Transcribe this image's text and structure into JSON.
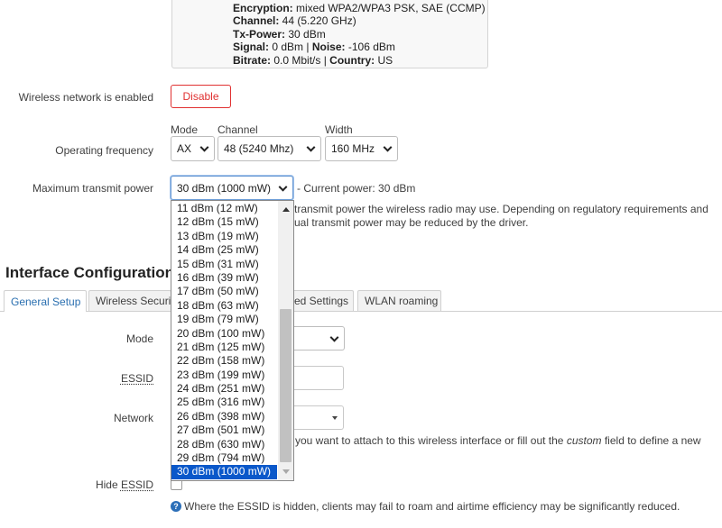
{
  "status": {
    "encryption_label": "Encryption:",
    "encryption_value": " mixed WPA2/WPA3 PSK, SAE (CCMP)",
    "channel_label": "Channel:",
    "channel_value": " 44 (5.220 GHz)",
    "txpower_label": "Tx-Power:",
    "txpower_value": " 30 dBm",
    "signal_label": "Signal:",
    "signal_value": " 0 dBm | ",
    "noise_label": "Noise:",
    "noise_value": " -106 dBm",
    "bitrate_label": "Bitrate:",
    "bitrate_value": " 0.0 Mbit/s | ",
    "country_label": "Country:",
    "country_value": " US"
  },
  "wireless_enabled": {
    "label": "Wireless network is enabled",
    "button": "Disable"
  },
  "frequency": {
    "label": "Operating frequency",
    "mode_label": "Mode",
    "mode_value": "AX",
    "channel_label": "Channel",
    "channel_value": "48 (5240 Mhz)",
    "width_label": "Width",
    "width_value": "160 MHz"
  },
  "txpower": {
    "label": "Maximum transmit power",
    "value": "30 dBm (1000 mW)",
    "current": "- Current power: 30 dBm",
    "desc_line1": "transmit power the wireless radio may use. Depending on regulatory requirements and",
    "desc_line2": "ual transmit power may be reduced by the driver.",
    "options": [
      "11 dBm (12 mW)",
      "12 dBm (15 mW)",
      "13 dBm (19 mW)",
      "14 dBm (25 mW)",
      "15 dBm (31 mW)",
      "16 dBm (39 mW)",
      "17 dBm (50 mW)",
      "18 dBm (63 mW)",
      "19 dBm (79 mW)",
      "20 dBm (100 mW)",
      "21 dBm (125 mW)",
      "22 dBm (158 mW)",
      "23 dBm (199 mW)",
      "24 dBm (251 mW)",
      "25 dBm (316 mW)",
      "26 dBm (398 mW)",
      "27 dBm (501 mW)",
      "28 dBm (630 mW)",
      "29 dBm (794 mW)",
      "30 dBm (1000 mW)"
    ],
    "selected_index": 19
  },
  "interface": {
    "title": "Interface Configuration",
    "tabs": {
      "general": "General Setup",
      "wireless_security": "Wireless Securit",
      "advanced": "ed Settings",
      "roaming": "WLAN roaming"
    }
  },
  "form": {
    "mode_label": "Mode",
    "essid_label": "ESSID",
    "network_label": "Network",
    "network_desc_prefix": "you want to attach to this wireless interface or fill out the ",
    "network_desc_custom": "custom",
    "network_desc_suffix": " field to define a new",
    "hide_essid_label": "Hide ",
    "hide_essid_label_abbr": "ESSID",
    "hide_help": "Where the ESSID is hidden, clients may fail to roam and airtime efficiency may be significantly reduced.",
    "help_icon_glyph": "?"
  },
  "colors": {
    "accent": "#2a6fb0",
    "danger": "#e03131",
    "selected": "#0a58ca"
  }
}
